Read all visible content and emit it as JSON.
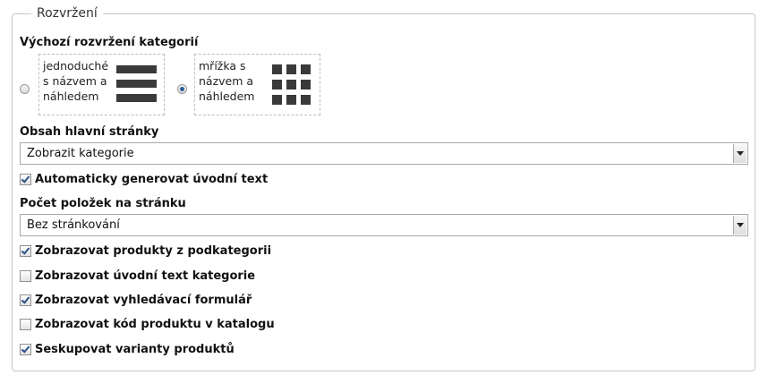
{
  "fieldset": {
    "legend": "Rozvržení"
  },
  "category_layout": {
    "label": "Výchozí rozvržení kategorií",
    "options": [
      {
        "text": "jednoduché\ns názvem a\nnáhledem",
        "icon": "list-layout-icon",
        "selected": false
      },
      {
        "text": "mřížka s\nnázvem a\nnáhledem",
        "icon": "grid-layout-icon",
        "selected": true
      }
    ]
  },
  "main_page_content": {
    "label": "Obsah hlavní stránky",
    "value": "Zobrazit kategorie"
  },
  "auto_intro": {
    "label": "Automaticky generovat úvodní text",
    "checked": true
  },
  "items_per_page": {
    "label": "Počet položek na stránku",
    "value": "Bez stránkování"
  },
  "checkboxes": [
    {
      "label": "Zobrazovat produkty z podkategorii",
      "checked": true
    },
    {
      "label": "Zobrazovat úvodní text kategorie",
      "checked": false
    },
    {
      "label": "Zobrazovat vyhledávací formulář",
      "checked": true
    },
    {
      "label": "Zobrazovat kód produktu v katalogu",
      "checked": false
    },
    {
      "label": "Seskupovat varianty produktů",
      "checked": true
    }
  ]
}
